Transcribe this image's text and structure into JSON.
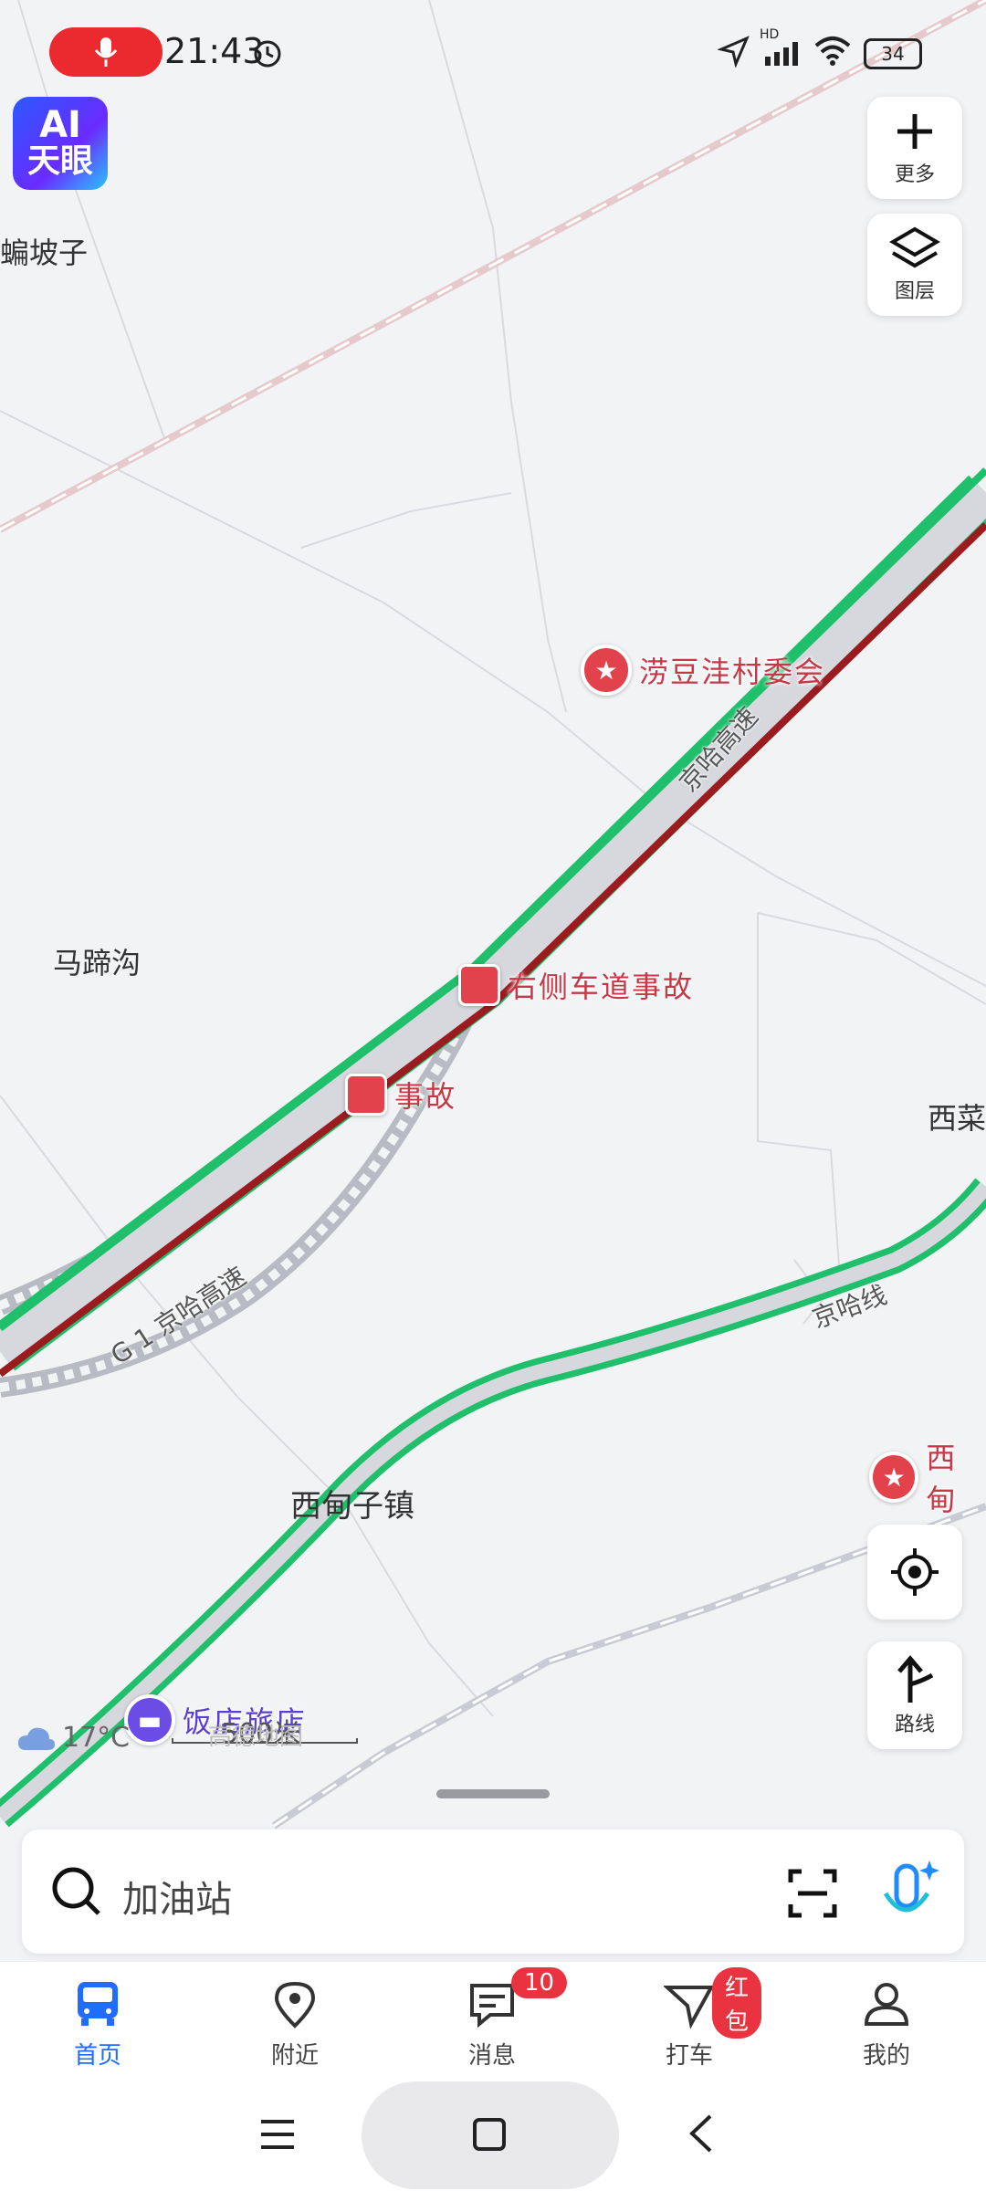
{
  "status_bar": {
    "time": "21:43",
    "battery": "34",
    "network_badge": "HD"
  },
  "ai_logo": {
    "line1": "AI",
    "line2": "天眼"
  },
  "side_buttons": {
    "more": "更多",
    "layers": "图层",
    "route": "路线"
  },
  "map": {
    "place_labels": [
      "蝙坡子",
      "马蹄沟",
      "西菜",
      "西甸子镇"
    ],
    "pois": [
      {
        "name": "涝豆洼村委会",
        "type": "star"
      },
      {
        "name": "西甸",
        "type": "star"
      },
      {
        "name": "饭店旅店",
        "type": "hotel"
      }
    ],
    "incidents": [
      "右侧车道事故",
      "事故"
    ],
    "road_labels": [
      "京哈高速",
      "G 1 京哈高速",
      "京哈线"
    ],
    "attribution": "高德地图"
  },
  "weather": {
    "temp": "17°C",
    "icon": "cloud-icon"
  },
  "scale": {
    "value": "500米"
  },
  "search": {
    "placeholder": "加油站"
  },
  "tabs": [
    {
      "label": "首页",
      "active": true,
      "icon": "bus-icon"
    },
    {
      "label": "附近",
      "icon": "location-pin-icon"
    },
    {
      "label": "消息",
      "badge": "10",
      "icon": "message-icon"
    },
    {
      "label": "打车",
      "badge": "红包",
      "icon": "taxi-icon"
    },
    {
      "label": "我的",
      "icon": "user-icon"
    }
  ],
  "colors": {
    "accent": "#1f6cff",
    "traffic_smooth": "#1fbf6b",
    "traffic_congested": "#9a1c1f",
    "poi": "#e2424c"
  }
}
